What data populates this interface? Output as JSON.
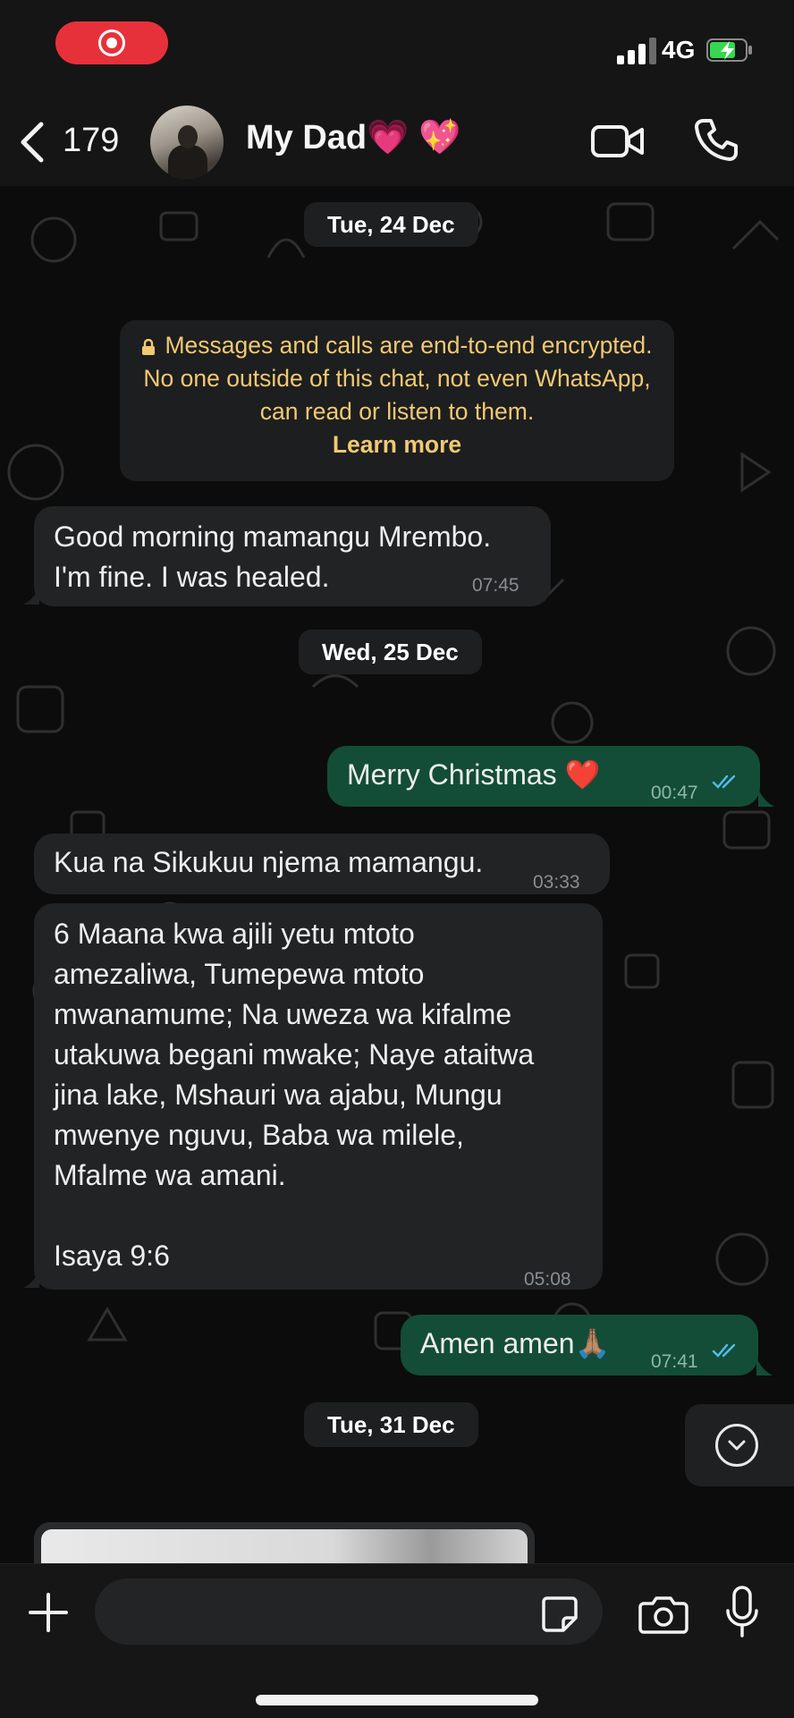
{
  "status_bar": {
    "network": "4G"
  },
  "header": {
    "back_count": "179",
    "chat_name": "My Dad💗 💖"
  },
  "dates": {
    "d1": "Tue, 24 Dec",
    "d2": "Wed, 25 Dec",
    "d3": "Tue, 31 Dec"
  },
  "encryption": {
    "text": "Messages and calls are end-to-end encrypted. No one outside of this chat, not even WhatsApp, can read or listen to them.",
    "link": "Learn more"
  },
  "messages": [
    {
      "direction": "in",
      "line1": "Good morning mamangu Mrembo.",
      "line2": "I'm fine. I was healed.",
      "time": "07:45"
    },
    {
      "direction": "out",
      "text": "Merry Christmas ❤️",
      "time": "00:47",
      "status": "read"
    },
    {
      "direction": "in",
      "text": "Kua na Sikukuu njema mamangu.",
      "time": "03:33"
    },
    {
      "direction": "in",
      "lines": [
        "6  Maana kwa ajili yetu mtoto",
        "amezaliwa, Tumepewa mtoto",
        "mwanamume; Na uweza wa kifalme",
        "utakuwa begani mwake; Naye ataitwa",
        "jina lake, Mshauri wa ajabu, Mungu",
        "mwenye nguvu, Baba wa milele,",
        "Mfalme wa amani."
      ],
      "ref": "Isaya 9:6",
      "time": "05:08"
    },
    {
      "direction": "out",
      "text": "Amen amen🙏🏽",
      "time": "07:41",
      "status": "read"
    }
  ],
  "input": {
    "value": "",
    "placeholder": ""
  },
  "colors": {
    "outgoing": "#144d37",
    "incoming": "#222324",
    "encryption_text": "#f1c972",
    "read_ticks": "#53bdeb",
    "record_pill": "#e7313a"
  },
  "icons": [
    "record-icon",
    "signal-icon",
    "battery-charging-icon",
    "back-chevron-icon",
    "video-call-icon",
    "phone-icon",
    "lock-icon",
    "double-check-icon",
    "chevron-down-circle-icon",
    "plus-icon",
    "sticker-icon",
    "camera-icon",
    "mic-icon"
  ]
}
